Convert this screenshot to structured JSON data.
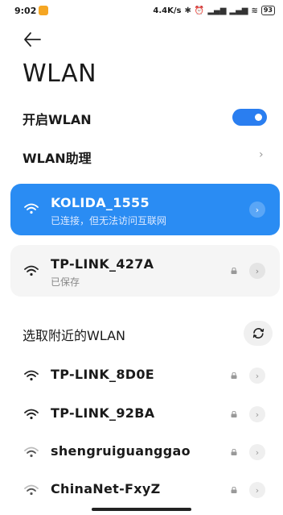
{
  "status_bar": {
    "time": "9:02",
    "speed": "4.4K/s",
    "battery": "93"
  },
  "page": {
    "title": "WLAN"
  },
  "settings": {
    "enable_label": "开启WLAN",
    "enabled": true,
    "assistant_label": "WLAN助理"
  },
  "connected": {
    "ssid": "KOLIDA_1555",
    "status": "已连接，但无法访问互联网"
  },
  "saved": {
    "ssid": "TP-LINK_427A",
    "status": "已保存"
  },
  "nearby": {
    "section_label": "选取附近的WLAN",
    "networks": [
      {
        "ssid": "TP-LINK_8D0E"
      },
      {
        "ssid": "TP-LINK_92BA"
      },
      {
        "ssid": "shengruiguanggao"
      },
      {
        "ssid": "ChinaNet-FxyZ"
      }
    ]
  },
  "colors": {
    "accent": "#2a8cf3",
    "toggle": "#2a7ef0"
  }
}
